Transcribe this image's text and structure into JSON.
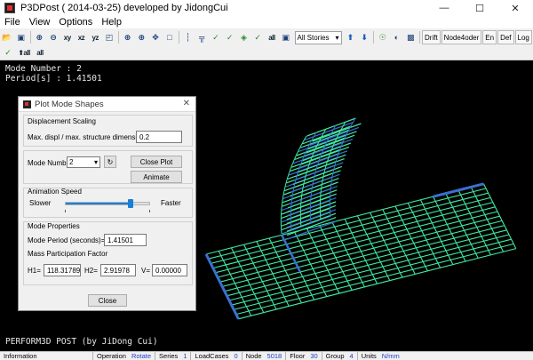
{
  "window": {
    "title": "P3DPost ( 2014-03-25)  developed by JidongCui"
  },
  "menu": {
    "items": [
      "File",
      "View",
      "Options",
      "Help"
    ]
  },
  "toolbar": {
    "stories_value": "All Stories",
    "xy": "xy",
    "xz": "xz",
    "yz": "yz",
    "all_label": "all",
    "drift_label": "Drift",
    "node4oder_label": "Node4oder",
    "en_label": "En",
    "def_label": "Def",
    "log_label": "Log"
  },
  "viewport": {
    "mode_number_text": "Mode Number : 2",
    "period_text": "Period[s] : 1.41501",
    "footer_text": "PERFORM3D POST (by JiDong Cui)"
  },
  "dialog": {
    "title": "Plot Mode Shapes",
    "displacement_group": "Displacement Scaling",
    "max_displ_label": "Max. displ / max. structure dimension",
    "max_displ_value": "0.2",
    "mode_number_label": "Mode Number",
    "mode_number_value": "2",
    "close_plot_label": "Close Plot",
    "animate_label": "Animate",
    "animation_group": "Animation Speed",
    "slower_label": "Slower",
    "faster_label": "Faster",
    "animation_speed": 0.78,
    "mode_properties_group": "Mode Properties",
    "mode_period_label": "Mode Period (seconds)=",
    "mode_period_value": "1.41501",
    "mass_participation_label": "Mass Participation Factor",
    "h1_label": "H1=",
    "h1_value": "118.31789",
    "h2_label": "H2=",
    "h2_value": "2.91978",
    "v_label": "V=",
    "v_value": "0.00000",
    "close_label": "Close"
  },
  "status": {
    "information_label": "Information",
    "operation_label": "Operation",
    "operation_value": "Rotate",
    "series_label": "Series",
    "series_value": "1",
    "loadcases_label": "LoadCases",
    "loadcases_value": "0",
    "node_label": "Node",
    "node_value": "5018",
    "floor_label": "Floor",
    "floor_value": "30",
    "group_label": "Group",
    "group_value": "4",
    "units_label": "Units",
    "units_value": "N/mm"
  },
  "colors": {
    "mesh": "#40e8a0",
    "wall": "#3a6fd0",
    "selection": "#1a7fd9"
  }
}
